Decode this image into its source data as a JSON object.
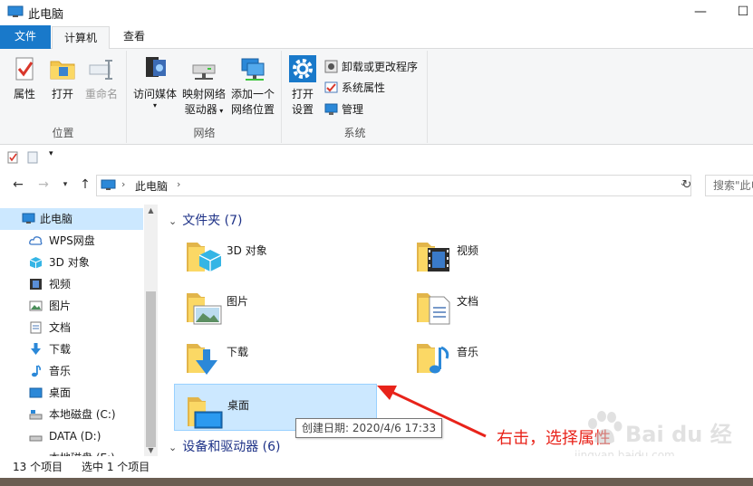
{
  "window": {
    "title": "此电脑",
    "minimize": "—",
    "maximize": "☐"
  },
  "tabs": {
    "file": "文件",
    "computer": "计算机",
    "view": "查看"
  },
  "ribbon": {
    "location": {
      "label": "位置",
      "properties": "属性",
      "open": "打开",
      "rename": "重命名"
    },
    "network": {
      "label": "网络",
      "access_media": "访问媒体",
      "map_drive_1": "映射网络",
      "map_drive_2": "驱动器",
      "add_location_1": "添加一个",
      "add_location_2": "网络位置"
    },
    "system": {
      "label": "系统",
      "open_settings_1": "打开",
      "open_settings_2": "设置",
      "uninstall": "卸载或更改程序",
      "sys_props": "系统属性",
      "manage": "管理"
    }
  },
  "address": {
    "crumb": "此电脑",
    "search_placeholder": "搜索\"此电脑\""
  },
  "nav_pane": {
    "items": [
      {
        "label": "此电脑",
        "icon": "pc-icon"
      },
      {
        "label": "WPS网盘",
        "icon": "cloud-icon"
      },
      {
        "label": "3D 对象",
        "icon": "cube-icon"
      },
      {
        "label": "视频",
        "icon": "video-icon"
      },
      {
        "label": "图片",
        "icon": "picture-icon"
      },
      {
        "label": "文档",
        "icon": "document-icon"
      },
      {
        "label": "下载",
        "icon": "download-icon"
      },
      {
        "label": "音乐",
        "icon": "music-icon"
      },
      {
        "label": "桌面",
        "icon": "desktop-icon"
      },
      {
        "label": "本地磁盘 (C:)",
        "icon": "drive-icon"
      },
      {
        "label": "DATA (D:)",
        "icon": "drive-icon"
      },
      {
        "label": "本地磁盘 (E:)",
        "icon": "drive-icon"
      }
    ]
  },
  "content": {
    "folders_header": "文件夹 (7)",
    "devices_header": "设备和驱动器 (6)",
    "folders": [
      {
        "label": "3D 对象"
      },
      {
        "label": "视频"
      },
      {
        "label": "图片"
      },
      {
        "label": "文档"
      },
      {
        "label": "下载"
      },
      {
        "label": "音乐"
      },
      {
        "label": "桌面"
      }
    ],
    "tooltip": "创建日期: 2020/4/6 17:33"
  },
  "annotation": "右击，选择属性",
  "watermark": {
    "text": "Bai du 经验",
    "url": "jingyan.baidu.com"
  },
  "status": {
    "count": "13 个项目",
    "selected": "选中 1 个项目"
  },
  "colors": {
    "accent": "#1979ca",
    "selection": "#cce8ff",
    "annotation": "#e8231a"
  }
}
